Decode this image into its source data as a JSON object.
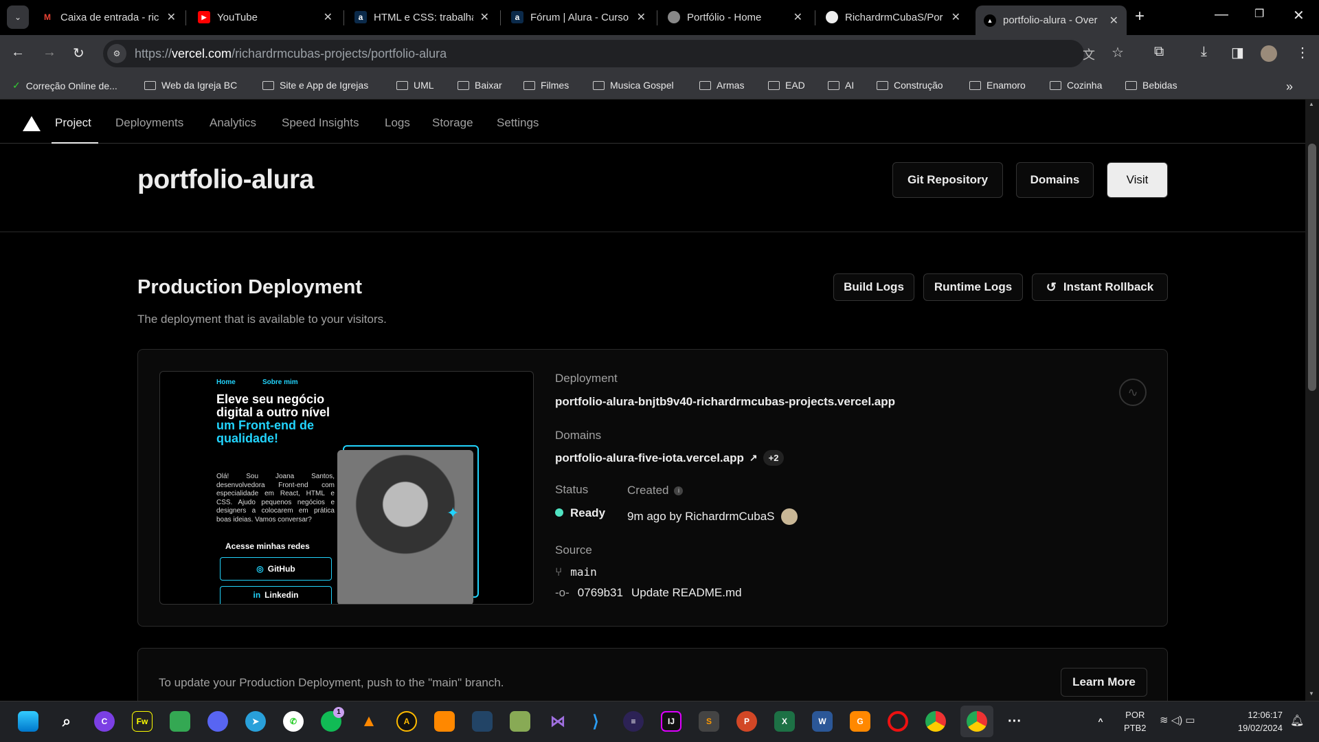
{
  "browser": {
    "tabs": [
      {
        "title": "Caixa de entrada - ric",
        "icon": "gmail-icon"
      },
      {
        "title": "YouTube",
        "icon": "youtube-icon"
      },
      {
        "title": "HTML e CSS: trabalha",
        "icon": "alura-icon"
      },
      {
        "title": "Fórum | Alura - Curso",
        "icon": "alura-icon"
      },
      {
        "title": "Portfólio - Home",
        "icon": "globe-icon"
      },
      {
        "title": "RichardrmCubaS/Por",
        "icon": "github-icon"
      },
      {
        "title": "portfolio-alura - Over",
        "icon": "vercel-icon",
        "active": true
      }
    ],
    "url_scheme": "https://",
    "url_host": "vercel.com",
    "url_path": "/richardrmcubas-projects/portfolio-alura",
    "bookmarks": [
      "Correção Online de...",
      "Web da Igreja BC",
      "Site e App de Igrejas",
      "UML",
      "Baixar",
      "Filmes",
      "Musica Gospel",
      "Armas",
      "EAD",
      "AI",
      "Construção",
      "Enamoro",
      "Cozinha",
      "Bebidas"
    ]
  },
  "nav": {
    "items": [
      "Project",
      "Deployments",
      "Analytics",
      "Speed Insights",
      "Logs",
      "Storage",
      "Settings"
    ],
    "active": "Project"
  },
  "header": {
    "title": "portfolio-alura",
    "git_repo": "Git Repository",
    "domains": "Domains",
    "visit": "Visit"
  },
  "production": {
    "title": "Production Deployment",
    "subtitle": "The deployment that is available to your visitors.",
    "build_logs": "Build Logs",
    "runtime_logs": "Runtime Logs",
    "rollback": "Instant Rollback",
    "deployment_label": "Deployment",
    "deployment_url": "portfolio-alura-bnjtb9v40-richardrmcubas-projects.vercel.app",
    "domains_label": "Domains",
    "domain": "portfolio-alura-five-iota.vercel.app",
    "domain_extra": "+2",
    "status_label": "Status",
    "status": "Ready",
    "status_color": "#50e3c2",
    "created_label": "Created",
    "created": "9m ago by RichardrmCubaS",
    "source_label": "Source",
    "branch": "main",
    "commit_hash": "0769b31",
    "commit_msg": "Update README.md"
  },
  "preview": {
    "nav": [
      "Home",
      "Sobre mim"
    ],
    "headline_white": "Eleve seu negócio digital a outro nível",
    "headline_blue": "um Front-end de qualidade!",
    "body": "Olá! Sou Joana Santos, desenvolvedora Front-end com especialidade em React, HTML e CSS. Ajudo pequenos negócios e designers a colocarem em prática boas ideias. Vamos conversar?",
    "socials_title": "Acesse minhas redes",
    "github": "GitHub",
    "linkedin": "Linkedin",
    "accent": "#22d4fd"
  },
  "update_card": {
    "text": "To update your Production Deployment, push to the \"main\" branch.",
    "learn_more": "Learn More"
  },
  "taskbar": {
    "lang": "POR",
    "layout": "PTB2",
    "time": "12:06:17",
    "date": "19/02/2024",
    "whatsapp_badge": "1"
  }
}
